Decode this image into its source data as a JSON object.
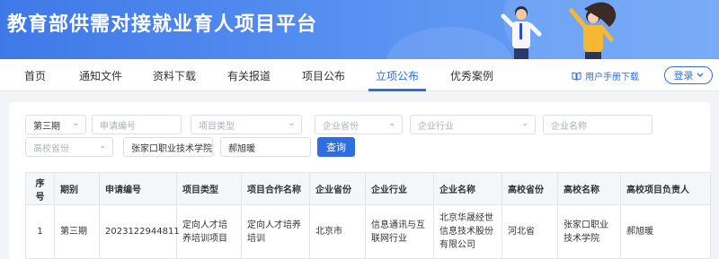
{
  "header": {
    "title": "教育部供需对接就业育人项目平台"
  },
  "nav": {
    "items": [
      "首页",
      "通知文件",
      "资料下载",
      "有关报道",
      "项目公布",
      "立项公布",
      "优秀案例"
    ],
    "active": "立项公布",
    "manual_label": "用户手册下载",
    "login_label": "登录"
  },
  "filters": {
    "batch": "第三期",
    "application_no": "申请编号",
    "project_type": "项目类型",
    "company_province": "企业省份",
    "company_industry": "企业行业",
    "company_name": "企业名称",
    "school_province": "高校省份",
    "school_name": "张家口职业技术学院",
    "leader": "郝旭暖",
    "query_label": "查询"
  },
  "table": {
    "headers": [
      "序号",
      "期别",
      "申请编号",
      "项目类型",
      "项目合作名称",
      "企业省份",
      "企业行业",
      "企业名称",
      "高校省份",
      "高校名称",
      "高校项目负责人"
    ],
    "rows": [
      [
        "1",
        "第三期",
        "2023122944811",
        "定向人才培养培训项目",
        "定向人才培养培训",
        "北京市",
        "信息通讯与互联网行业",
        "北京华晟经世信息技术股份有限公司",
        "河北省",
        "张家口职业技术学院",
        "郝旭暖"
      ]
    ]
  },
  "colors": {
    "accent": "#2f6ee0",
    "banner": "#4a86ee"
  }
}
